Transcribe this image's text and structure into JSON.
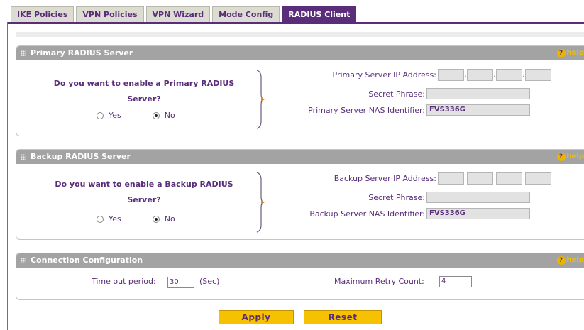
{
  "tabs": [
    "IKE Policies",
    "VPN Policies",
    "VPN Wizard",
    "Mode Config",
    "RADIUS Client"
  ],
  "active_tab": "RADIUS Client",
  "help_label": "help",
  "primary": {
    "title": "Primary RADIUS Server",
    "question_line1": "Do you want to enable a Primary RADIUS",
    "question_line2": "Server?",
    "yes_label": "Yes",
    "no_label": "No",
    "selected": "No",
    "ip_label": "Primary Server IP Address:",
    "secret_label": "Secret Phrase:",
    "nas_label": "Primary Server NAS Identifier:",
    "nas_value": "FVS336G"
  },
  "backup": {
    "title": "Backup RADIUS Server",
    "question_line1": "Do you want to enable a Backup RADIUS",
    "question_line2": "Server?",
    "yes_label": "Yes",
    "no_label": "No",
    "selected": "No",
    "ip_label": "Backup Server IP Address:",
    "secret_label": "Secret Phrase:",
    "nas_label": "Backup Server NAS Identifier:",
    "nas_value": "FVS336G"
  },
  "connection": {
    "title": "Connection Configuration",
    "timeout_label": "Time out period:",
    "timeout_value": "30",
    "timeout_unit": "(Sec)",
    "retry_label": "Maximum Retry Count:",
    "retry_value": "4"
  },
  "buttons": {
    "apply": "Apply",
    "reset": "Reset"
  },
  "colors": {
    "accent": "#5a2d7a",
    "header_gray": "#a3a3a3",
    "button_yellow": "#f6c100"
  }
}
